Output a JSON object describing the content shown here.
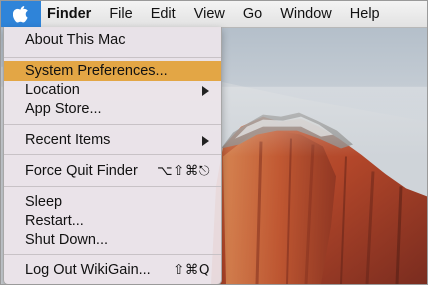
{
  "menubar": {
    "apple_icon": "apple-logo-icon",
    "app_name": "Finder",
    "items": [
      "File",
      "Edit",
      "View",
      "Go",
      "Window",
      "Help"
    ]
  },
  "apple_menu": {
    "about": "About This Mac",
    "system_prefs": "System Preferences...",
    "location": "Location",
    "app_store": "App Store...",
    "recent_items": "Recent Items",
    "force_quit": "Force Quit Finder",
    "force_quit_shortcut": "⌥⇧⌘⎋",
    "sleep": "Sleep",
    "restart": "Restart...",
    "shut_down": "Shut Down...",
    "log_out": "Log Out WikiGain...",
    "log_out_shortcut": "⇧⌘Q"
  },
  "colors": {
    "apple_highlight": "#2f84d9",
    "selected_item": "#e3a645"
  }
}
